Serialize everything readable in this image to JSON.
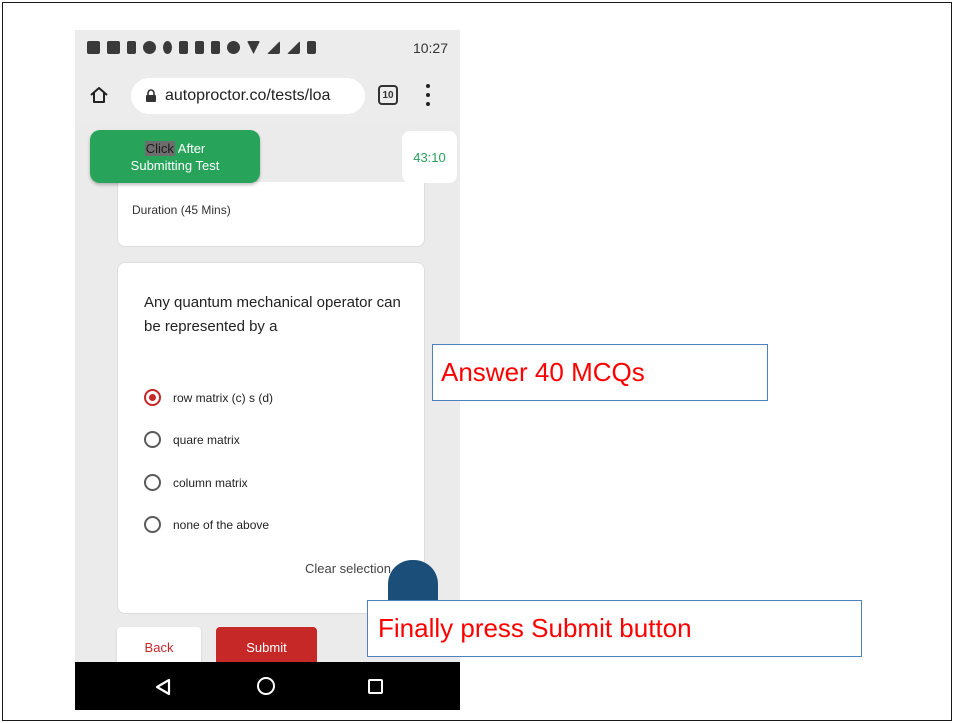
{
  "status_bar": {
    "time": "10:27",
    "icons": [
      "notification-icon",
      "gmail-icon",
      "usb-icon",
      "circle-icon",
      "data-icon",
      "screenshot-icon",
      "image-icon",
      "missed-call-icon",
      "alarm-icon",
      "wifi-icon",
      "signal-icon",
      "signal-icon",
      "battery-icon"
    ]
  },
  "browser": {
    "url": "autoproctor.co/tests/loa",
    "tab_count": "10"
  },
  "page": {
    "click_button": {
      "highlight": "Click",
      "rest_line1": " After",
      "line2": "Submitting Test"
    },
    "timer": "43:10",
    "duration": "Duration  (45 Mins)",
    "question": "Any quantum mechanical operator can be represented by a",
    "options": [
      {
        "label": "row matrix (c) s (d)",
        "selected": true
      },
      {
        "label": "quare matrix",
        "selected": false
      },
      {
        "label": "column matrix",
        "selected": false
      },
      {
        "label": "none of the above",
        "selected": false
      }
    ],
    "clear_selection": "Clear selection",
    "back_label": "Back",
    "submit_label": "Submit"
  },
  "annotations": {
    "answer": "Answer 40 MCQs",
    "finally": "Finally press Submit button"
  },
  "colors": {
    "accent_green": "#27a35a",
    "accent_red": "#c62828",
    "annotation_text": "#ff0000",
    "annotation_border": "#4f81bd"
  }
}
